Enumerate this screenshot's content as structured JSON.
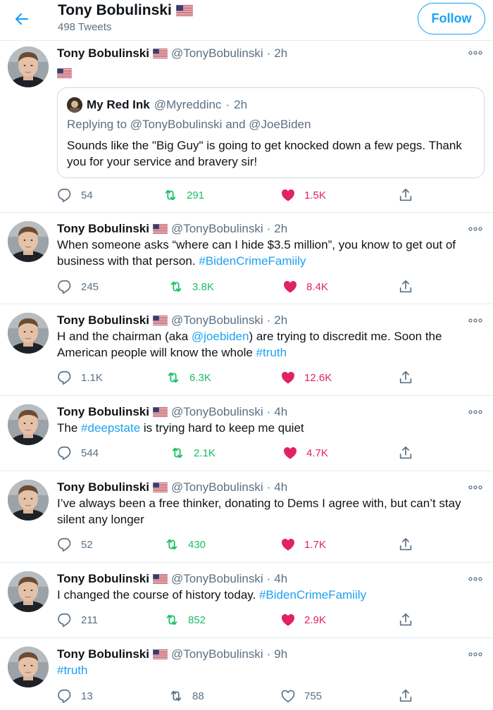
{
  "header": {
    "name": "Tony Bobulinski",
    "tweet_count": "498 Tweets",
    "follow_label": "Follow"
  },
  "colors": {
    "accent": "#1da1f2",
    "retweet": "#17bf63",
    "like": "#e0245e",
    "muted": "#5b7083"
  },
  "icons": [
    "back-arrow-icon",
    "flag-us-icon",
    "more-icon",
    "reply-icon",
    "retweet-icon",
    "heart-icon",
    "share-icon"
  ],
  "tweets": [
    {
      "name": "Tony Bobulinski",
      "handle": "@TonyBobulinski",
      "dot": "·",
      "time": "2h",
      "text": "",
      "quote": {
        "name": "My Red Ink",
        "handle": "@Myreddinc",
        "dot": "·",
        "time": "2h",
        "reply_prefix": "Replying to",
        "reply_user1": "@TonyBobulinski",
        "reply_and": "and",
        "reply_user2": "@JoeBiden",
        "text": "Sounds like the \"Big Guy\" is going to get knocked down a few pegs. Thank you for your service and bravery sir!"
      },
      "replies": "54",
      "retweets": "291",
      "likes": "1.5K",
      "liked": true
    },
    {
      "name": "Tony Bobulinski",
      "handle": "@TonyBobulinski",
      "dot": "·",
      "time": "2h",
      "text_a": "When someone asks “where can I hide $3.5 million”, you know to get out of business with that person. ",
      "text_tag": "#BidenCrimeFamiily",
      "replies": "245",
      "retweets": "3.8K",
      "likes": "8.4K",
      "liked": true
    },
    {
      "name": "Tony Bobulinski",
      "handle": "@TonyBobulinski",
      "dot": "·",
      "time": "2h",
      "text_a": "H and the chairman (aka ",
      "text_mention": "@joebiden",
      "text_b": ") are trying to discredit me. Soon the American people will know the whole ",
      "text_tag": "#truth",
      "replies": "1.1K",
      "retweets": "6.3K",
      "likes": "12.6K",
      "liked": true
    },
    {
      "name": "Tony Bobulinski",
      "handle": "@TonyBobulinski",
      "dot": "·",
      "time": "4h",
      "text_a": "The ",
      "text_tag": "#deepstate",
      "text_b": " is trying hard to keep me quiet",
      "replies": "544",
      "retweets": "2.1K",
      "likes": "4.7K",
      "liked": true
    },
    {
      "name": "Tony Bobulinski",
      "handle": "@TonyBobulinski",
      "dot": "·",
      "time": "4h",
      "text_a": "I’ve always been a free thinker, donating to Dems I agree with, but can’t stay silent any longer",
      "replies": "52",
      "retweets": "430",
      "likes": "1.7K",
      "liked": true
    },
    {
      "name": "Tony Bobulinski",
      "handle": "@TonyBobulinski",
      "dot": "·",
      "time": "4h",
      "text_a": "I changed the course of history today. ",
      "text_tag": "#BidenCrimeFamiily",
      "replies": "211",
      "retweets": "852",
      "likes": "2.9K",
      "liked": true
    },
    {
      "name": "Tony Bobulinski",
      "handle": "@TonyBobulinski",
      "dot": "·",
      "time": "9h",
      "text_tag": "#truth",
      "replies": "13",
      "retweets": "88",
      "likes": "755",
      "liked": false
    }
  ]
}
